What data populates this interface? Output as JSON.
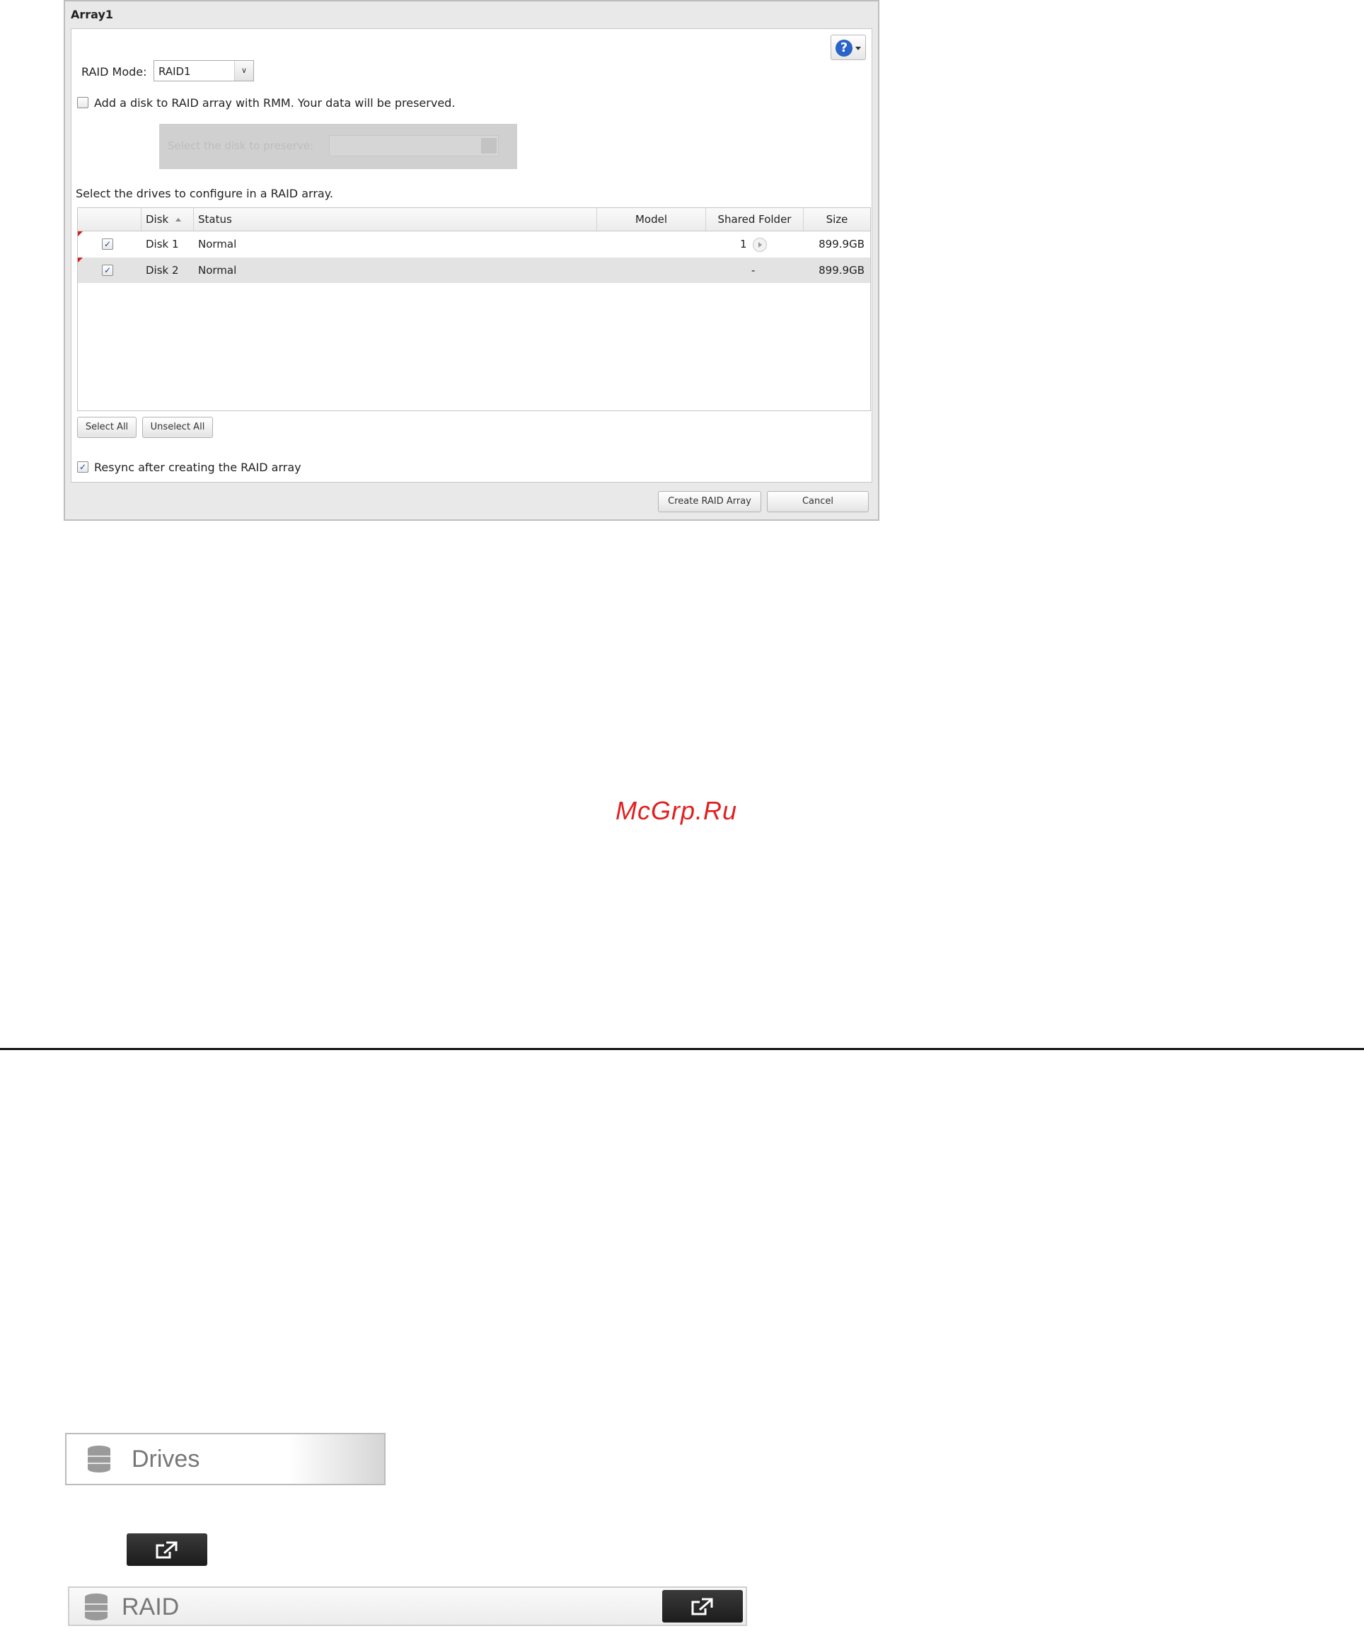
{
  "dialog": {
    "title": "Array1",
    "raid_mode_label": "RAID Mode:",
    "raid_mode_value": "RAID1",
    "rmm_label": "Add a disk to RAID array with RMM. Your data will be preserved.",
    "rmm_checked": false,
    "preserve_label": "Select the disk to preserve:",
    "select_drives_text": "Select the drives to configure in a RAID array.",
    "table": {
      "headers": [
        "Disk",
        "Status",
        "Model",
        "Shared Folder",
        "Size"
      ],
      "rows": [
        {
          "checked": true,
          "disk": "Disk 1",
          "status": "Normal",
          "model": "",
          "shared_folder": "1",
          "size": "899.9GB"
        },
        {
          "checked": true,
          "disk": "Disk 2",
          "status": "Normal",
          "model": "",
          "shared_folder": "-",
          "size": "899.9GB"
        }
      ]
    },
    "select_all": "Select All",
    "unselect_all": "Unselect All",
    "resync_label": "Resync after creating the RAID array",
    "resync_checked": true,
    "create_button": "Create RAID Array",
    "cancel_button": "Cancel",
    "help_icon": "question-icon"
  },
  "watermark": "McGrp.Ru",
  "drives_tab": {
    "label": "Drives",
    "icon": "database-icon"
  },
  "external_button": {
    "icon": "external-link-icon"
  },
  "raid_tab": {
    "label": "RAID",
    "icon": "database-icon"
  },
  "colors": {
    "accent": "#2a64c8",
    "watermark": "#e02020",
    "selected_row": "#e3e3e3"
  }
}
